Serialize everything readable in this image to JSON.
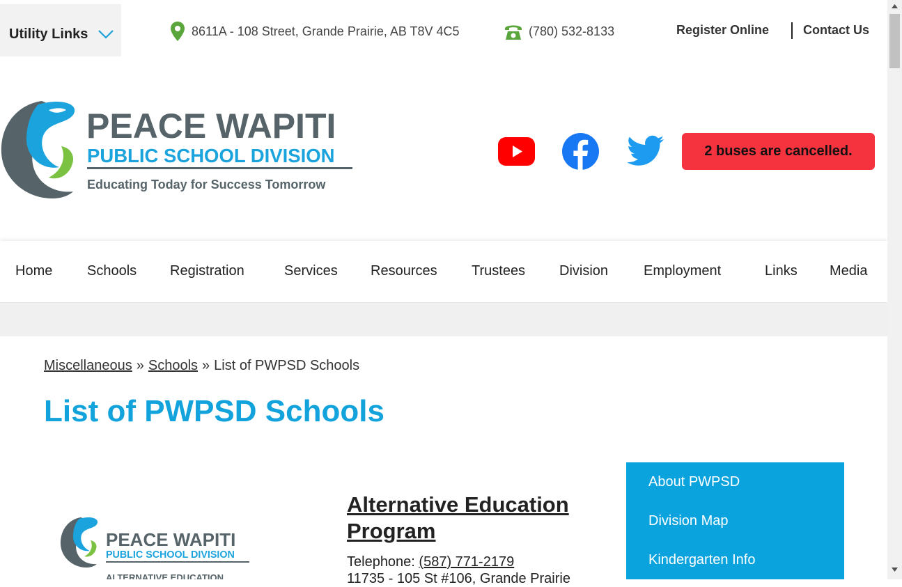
{
  "utility": {
    "label": "Utility Links"
  },
  "contact": {
    "address": "8611A - 108 Street, Grande Prairie, AB T8V 4C5",
    "phone": "(780) 532-8133"
  },
  "toplinks": {
    "register": "Register Online",
    "contact": "Contact Us"
  },
  "logo": {
    "line1": "PEACE WAPITI",
    "line2": "PUBLIC SCHOOL DIVISION",
    "tagline": "Educating Today for Success Tomorrow"
  },
  "alert": {
    "text": "2 buses are cancelled.",
    "color": "#f4333f"
  },
  "nav": {
    "items": [
      "Home",
      "Schools",
      "Registration",
      "Services",
      "Resources",
      "Trustees",
      "Division",
      "Employment",
      "Links",
      "Media"
    ]
  },
  "breadcrumb": {
    "crumb1": "Miscellaneous",
    "sep": "»",
    "crumb2": "Schools",
    "current": "List of PWPSD Schools"
  },
  "page": {
    "title": "List of PWPSD Schools"
  },
  "school": {
    "logo_line1": "PEACE WAPITI",
    "logo_line2": "PUBLIC SCHOOL DIVISION",
    "logo_line3": "ALTERNATIVE EDUCATION",
    "name": "Alternative Education Program",
    "tel_label": "Telephone: ",
    "tel": "(587) 771-2179",
    "address": "11735 - 105 St #106, Grande Prairie"
  },
  "sidebar": {
    "items": [
      "About PWPSD",
      "Division Map",
      "Kindergarten Info"
    ]
  },
  "colors": {
    "accent": "#12a3dc",
    "sidebar": "#0ba3dd",
    "icon_green": "#5aa63c"
  }
}
